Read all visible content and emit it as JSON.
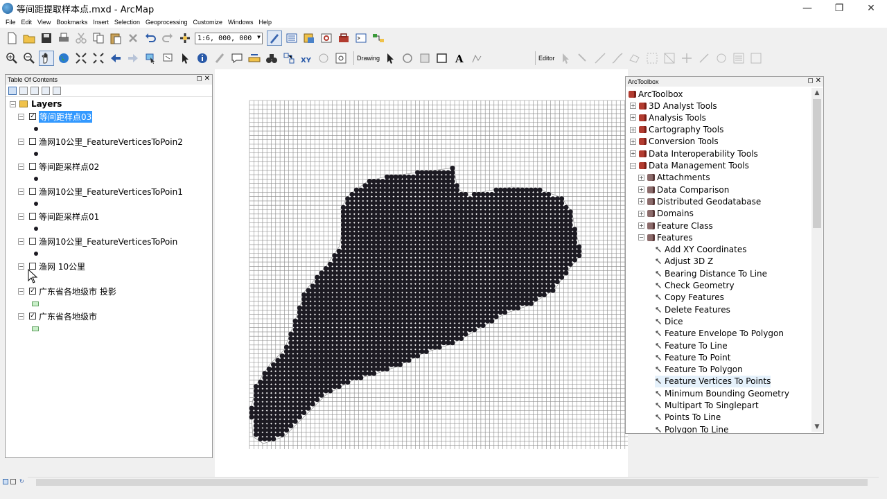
{
  "window": {
    "title": "等间距提取样本点.mxd - ArcMap",
    "minimize": "—",
    "restore": "❐",
    "close": "✕"
  },
  "menu": [
    "File",
    "Edit",
    "View",
    "Bookmarks",
    "Insert",
    "Selection",
    "Geoprocessing",
    "Customize",
    "Windows",
    "Help"
  ],
  "toolbar": {
    "scale": "1:6, 000, 000",
    "drawing_label": "Drawing",
    "editor_label": "Editor"
  },
  "toc": {
    "title": "Table Of Contents",
    "root": "Layers",
    "layers": [
      {
        "name": "等间距样点03",
        "checked": true,
        "selected": true,
        "symbol": "point"
      },
      {
        "name": "渔网10公里_FeatureVerticesToPoin2",
        "checked": false,
        "selected": false,
        "symbol": "point"
      },
      {
        "name": "等间距采样点02",
        "checked": false,
        "selected": false,
        "symbol": "point"
      },
      {
        "name": "渔网10公里_FeatureVerticesToPoin1",
        "checked": false,
        "selected": false,
        "symbol": "point"
      },
      {
        "name": "等间距采样点01",
        "checked": false,
        "selected": false,
        "symbol": "point"
      },
      {
        "name": "渔网10公里_FeatureVerticesToPoin",
        "checked": false,
        "selected": false,
        "symbol": "point"
      },
      {
        "name": "渔网 10公里",
        "checked": false,
        "selected": false,
        "symbol": "none"
      },
      {
        "name": "广东省各地级市 投影",
        "checked": true,
        "selected": false,
        "symbol": "polygon"
      },
      {
        "name": "广东省各地级市",
        "checked": true,
        "selected": false,
        "symbol": "polygon"
      }
    ]
  },
  "toolbox": {
    "title": "ArcToolbox",
    "root": "ArcToolbox",
    "items": [
      {
        "label": "3D Analyst Tools",
        "level": 1,
        "kind": "toolbox",
        "exp": "+"
      },
      {
        "label": "Analysis Tools",
        "level": 1,
        "kind": "toolbox",
        "exp": "+"
      },
      {
        "label": "Cartography Tools",
        "level": 1,
        "kind": "toolbox",
        "exp": "+"
      },
      {
        "label": "Conversion Tools",
        "level": 1,
        "kind": "toolbox",
        "exp": "+"
      },
      {
        "label": "Data Interoperability Tools",
        "level": 1,
        "kind": "toolbox",
        "exp": "+"
      },
      {
        "label": "Data Management Tools",
        "level": 1,
        "kind": "toolbox",
        "exp": "−"
      },
      {
        "label": "Attachments",
        "level": 2,
        "kind": "toolset",
        "exp": "+"
      },
      {
        "label": "Data Comparison",
        "level": 2,
        "kind": "toolset",
        "exp": "+"
      },
      {
        "label": "Distributed Geodatabase",
        "level": 2,
        "kind": "toolset",
        "exp": "+"
      },
      {
        "label": "Domains",
        "level": 2,
        "kind": "toolset",
        "exp": "+"
      },
      {
        "label": "Feature Class",
        "level": 2,
        "kind": "toolset",
        "exp": "+"
      },
      {
        "label": "Features",
        "level": 2,
        "kind": "toolset",
        "exp": "−"
      },
      {
        "label": "Add XY Coordinates",
        "level": 3,
        "kind": "tool"
      },
      {
        "label": "Adjust 3D Z",
        "level": 3,
        "kind": "tool"
      },
      {
        "label": "Bearing Distance To Line",
        "level": 3,
        "kind": "tool"
      },
      {
        "label": "Check Geometry",
        "level": 3,
        "kind": "tool"
      },
      {
        "label": "Copy Features",
        "level": 3,
        "kind": "tool"
      },
      {
        "label": "Delete Features",
        "level": 3,
        "kind": "tool"
      },
      {
        "label": "Dice",
        "level": 3,
        "kind": "tool"
      },
      {
        "label": "Feature Envelope To Polygon",
        "level": 3,
        "kind": "tool"
      },
      {
        "label": "Feature To Line",
        "level": 3,
        "kind": "tool"
      },
      {
        "label": "Feature To Point",
        "level": 3,
        "kind": "tool"
      },
      {
        "label": "Feature To Polygon",
        "level": 3,
        "kind": "tool"
      },
      {
        "label": "Feature Vertices To Points",
        "level": 3,
        "kind": "tool",
        "hover": true
      },
      {
        "label": "Minimum Bounding Geometry",
        "level": 3,
        "kind": "tool"
      },
      {
        "label": "Multipart To Singlepart",
        "level": 3,
        "kind": "tool"
      },
      {
        "label": "Points To Line",
        "level": 3,
        "kind": "tool"
      },
      {
        "label": "Polygon To Line",
        "level": 3,
        "kind": "tool"
      }
    ]
  },
  "map": {
    "point_color": "#1c1a22",
    "grid_color": "#8a8a8a"
  }
}
